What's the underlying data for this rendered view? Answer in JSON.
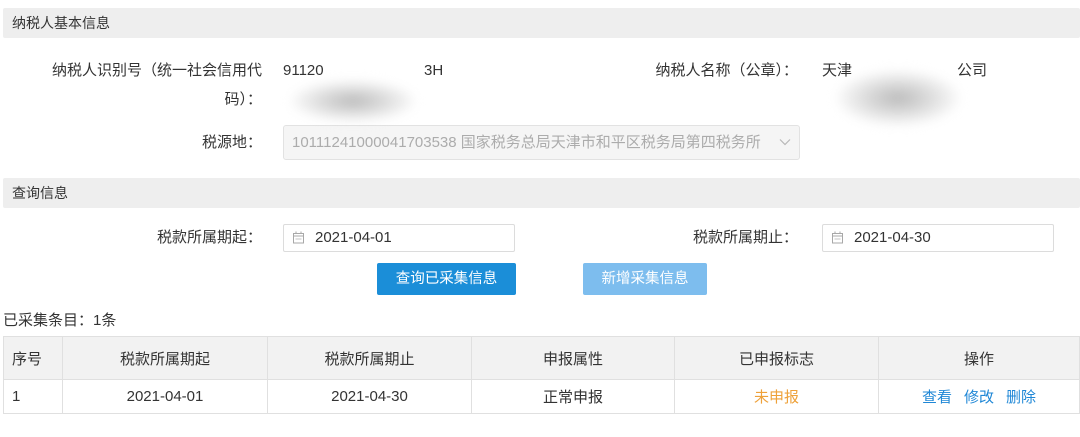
{
  "sections": {
    "basic_info": {
      "title": "纳税人基本信息"
    },
    "query_info": {
      "title": "查询信息"
    }
  },
  "taxpayer": {
    "id_label_line1": "纳税人识别号（统一社会信用代",
    "id_label_line2": "码）：",
    "id_value_prefix": "91120",
    "id_value_suffix": "3H",
    "name_label": "纳税人名称（公章）：",
    "name_value_prefix": "天津",
    "name_value_suffix": "公司",
    "tax_source_label": "税源地：",
    "tax_source_value": "10111241000041703538 国家税务总局天津市和平区税务局第四税务所"
  },
  "query": {
    "start_label": "税款所属期起：",
    "start_value": "2021-04-01",
    "end_label": "税款所属期止：",
    "end_value": "2021-04-30",
    "query_button": "查询已采集信息",
    "add_button": "新增采集信息"
  },
  "results": {
    "count_label": "已采集条目：",
    "count": "1",
    "count_unit": "条",
    "columns": [
      "序号",
      "税款所属期起",
      "税款所属期止",
      "申报属性",
      "已申报标志",
      "操作"
    ],
    "rows": [
      {
        "index": "1",
        "start": "2021-04-01",
        "end": "2021-04-30",
        "declare_attr": "正常申报",
        "declared_status": "未申报",
        "actions": [
          "查看",
          "修改",
          "删除"
        ]
      }
    ]
  },
  "icons": {
    "date_field": "calendar-icon",
    "select_dropdown": "chevron-down-icon"
  },
  "colors": {
    "text": "#333333",
    "section_bg": "#eeeeee",
    "primary": "#1b8ed8",
    "primary_light": "#7dbdee",
    "link": "#1f87d6",
    "warning": "#eea13a",
    "border": "#e0e0e0",
    "table_header_bg": "#f2f2f2",
    "disabled_bg": "#f5f5f5",
    "disabled_text": "#acacac"
  }
}
